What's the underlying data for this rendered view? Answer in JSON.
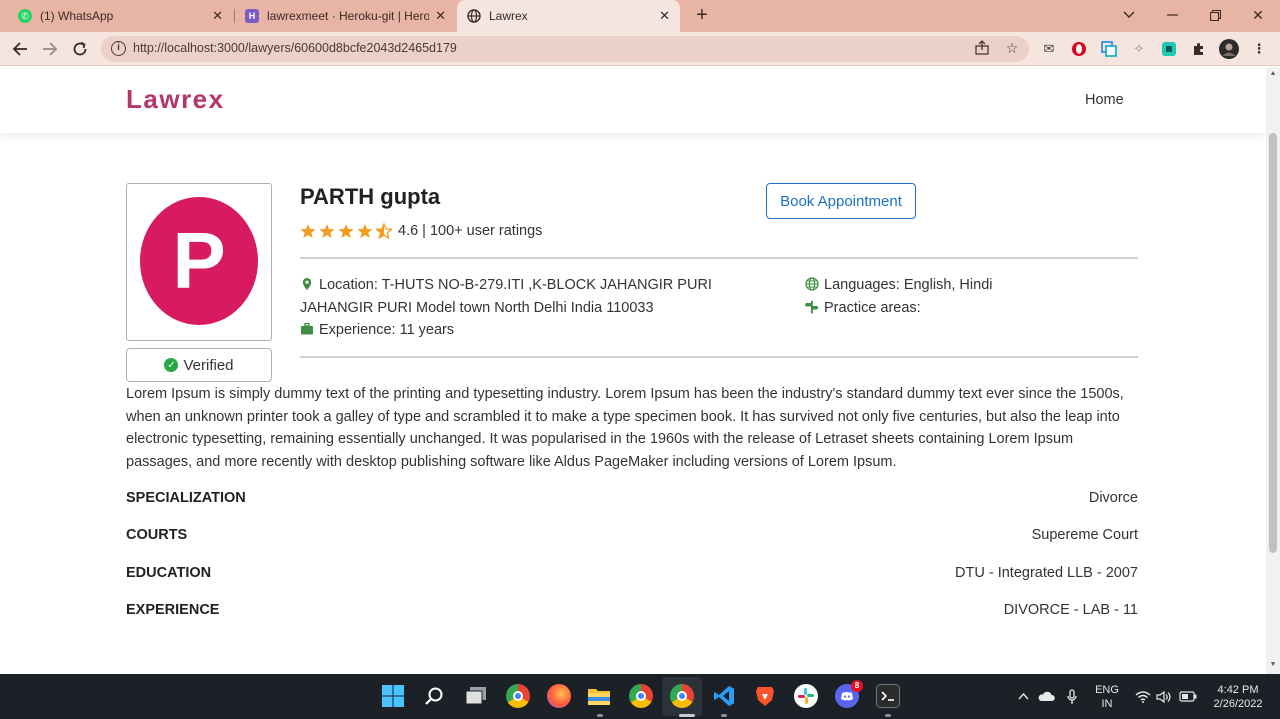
{
  "browser": {
    "tabs": [
      {
        "title": "(1) WhatsApp",
        "icon": "whatsapp-icon",
        "color": "#25d366"
      },
      {
        "title": "lawrexmeet · Heroku-git | Heroku",
        "icon": "heroku-icon",
        "color": "#7b5cc4"
      },
      {
        "title": "Lawrex",
        "icon": "globe-icon",
        "color": "#3c2a24"
      }
    ],
    "url": "http://localhost:3000/lawyers/60600d8bcfe2043d2465d179"
  },
  "site": {
    "brand": "Lawrex",
    "nav_home": "Home",
    "brand_color": "#b5366a"
  },
  "lawyer": {
    "initial": "P",
    "name": "PARTH gupta",
    "verified_label": "Verified",
    "rating": 4.6,
    "rating_text": "4.6 | 100+ user ratings",
    "book_label": "Book Appointment",
    "location": "Location: T-HUTS NO-B-279.ITI ,K-BLOCK JAHANGIR PURI JAHANGIR PURI Model town North Delhi India 110033",
    "experience": "Experience: 11 years",
    "languages": "Languages: English, Hindi",
    "practice_areas": "Practice areas:",
    "about": "Lorem Ipsum is simply dummy text of the printing and typesetting industry. Lorem Ipsum has been the industry's standard dummy text ever since the 1500s, when an unknown printer took a galley of type and scrambled it to make a type specimen book. It has survived not only five centuries, but also the leap into electronic typesetting, remaining essentially unchanged. It was popularised in the 1960s with the release of Letraset sheets containing Lorem Ipsum passages, and more recently with desktop publishing software like Aldus PageMaker including versions of Lorem Ipsum.",
    "details": [
      {
        "label": "SPECIALIZATION",
        "value": "Divorce"
      },
      {
        "label": "COURTS",
        "value": "Supereme Court"
      },
      {
        "label": "EDUCATION",
        "value": "DTU - Integrated LLB - 2007"
      },
      {
        "label": "EXPERIENCE",
        "value": "DIVORCE - LAB - 11"
      }
    ]
  },
  "taskbar": {
    "lang_line1": "ENG",
    "lang_line2": "IN",
    "time": "4:42 PM",
    "date": "2/26/2022",
    "discord_badge": "8"
  }
}
